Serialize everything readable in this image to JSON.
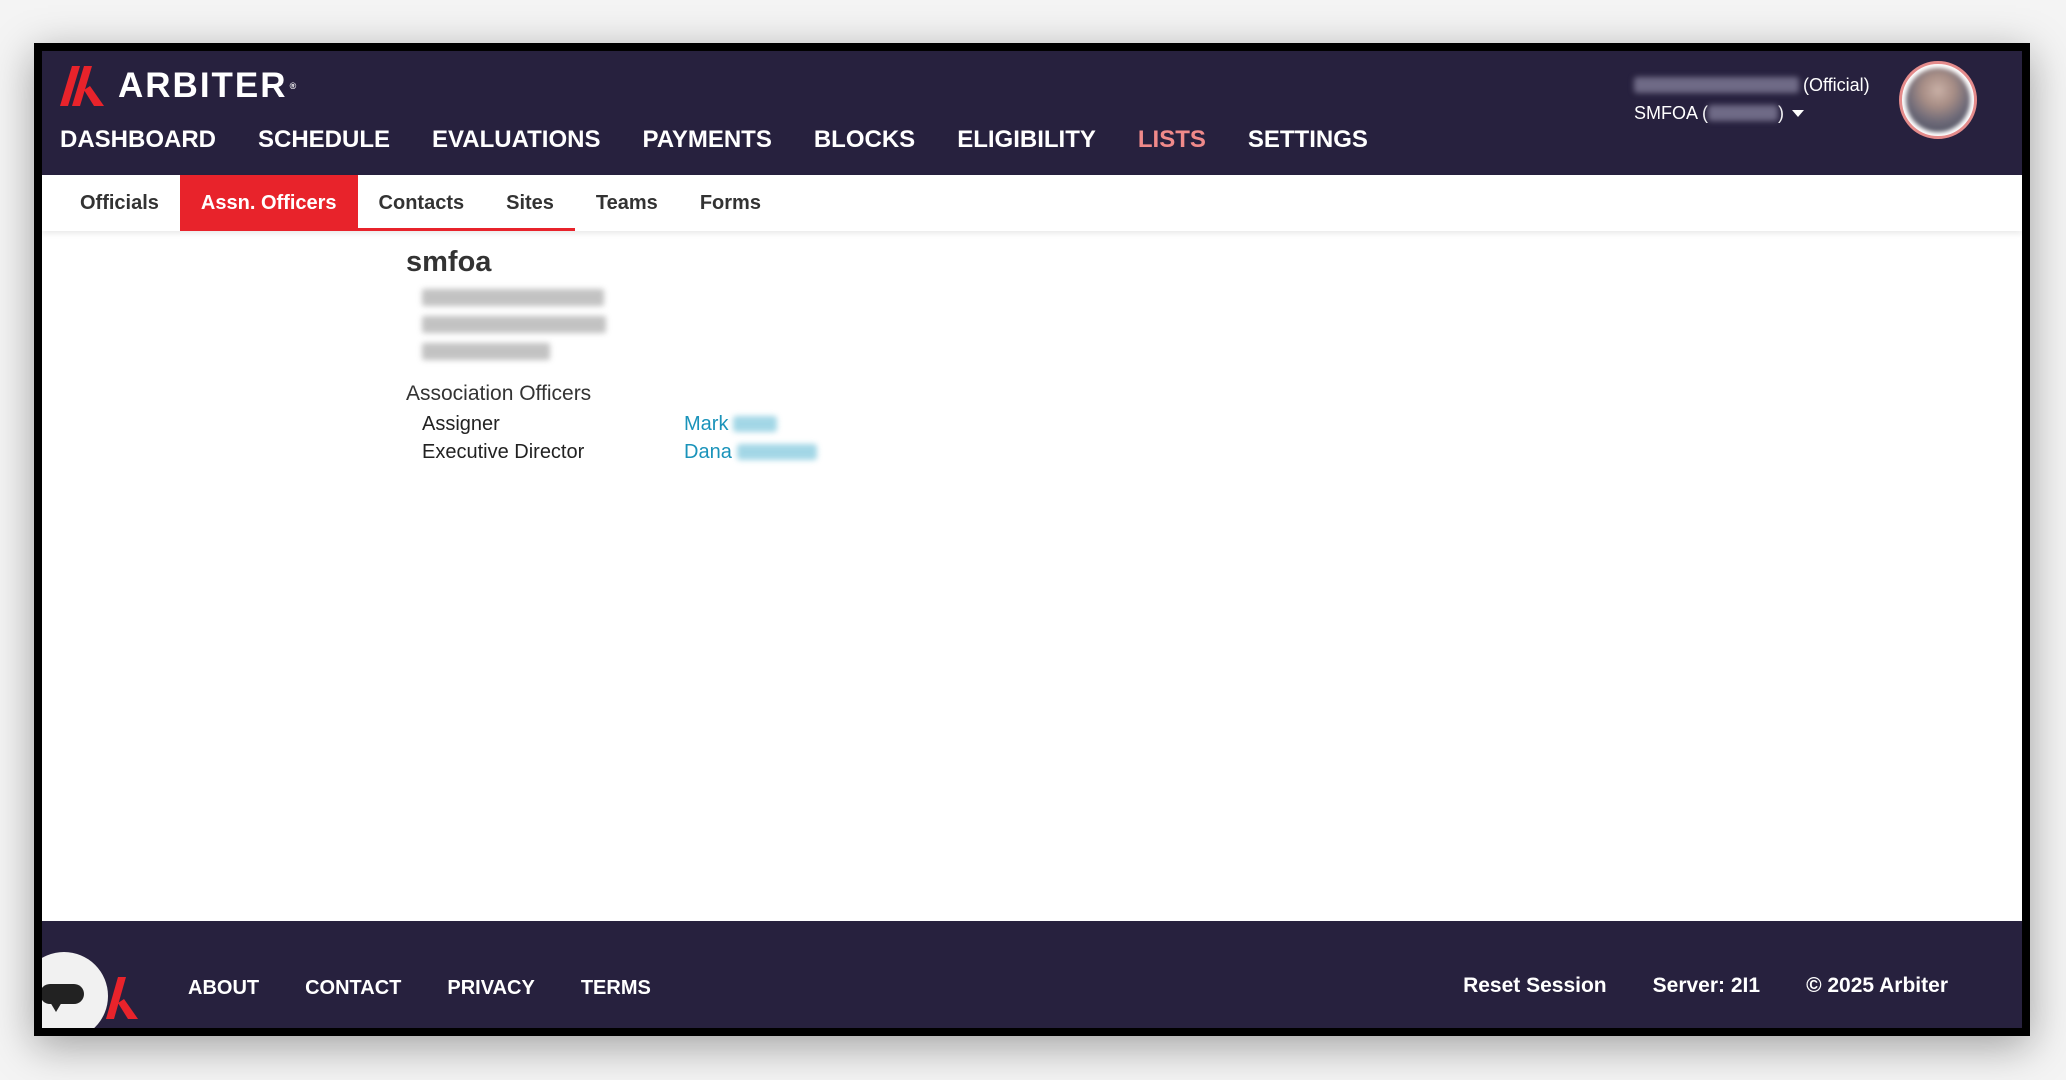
{
  "brand": {
    "name": "ARBITER",
    "mark": "®",
    "accent": "#e8232b",
    "header_bg": "#27213e"
  },
  "main_nav": [
    {
      "label": "DASHBOARD",
      "active": false
    },
    {
      "label": "SCHEDULE",
      "active": false
    },
    {
      "label": "EVALUATIONS",
      "active": false
    },
    {
      "label": "PAYMENTS",
      "active": false
    },
    {
      "label": "BLOCKS",
      "active": false
    },
    {
      "label": "ELIGIBILITY",
      "active": false
    },
    {
      "label": "LISTS",
      "active": true
    },
    {
      "label": "SETTINGS",
      "active": false
    }
  ],
  "user": {
    "role": "(Official)",
    "org_prefix": "SMFOA (",
    "org_suffix": ")"
  },
  "sub_nav": [
    {
      "label": "Officials",
      "active": false
    },
    {
      "label": "Assn. Officers",
      "active": true
    },
    {
      "label": "Contacts",
      "active": false
    },
    {
      "label": "Sites",
      "active": false
    },
    {
      "label": "Teams",
      "active": false
    },
    {
      "label": "Forms",
      "active": false
    }
  ],
  "content": {
    "org_name": "smfoa",
    "section_title": "Association Officers",
    "officers": [
      {
        "role": "Assigner",
        "name": "Mark"
      },
      {
        "role": "Executive Director",
        "name": "Dana"
      }
    ]
  },
  "footer": {
    "links": [
      "ABOUT",
      "CONTACT",
      "PRIVACY",
      "TERMS"
    ],
    "reset": "Reset Session",
    "server": "Server: 2I1",
    "copyright": "© 2025 Arbiter"
  }
}
